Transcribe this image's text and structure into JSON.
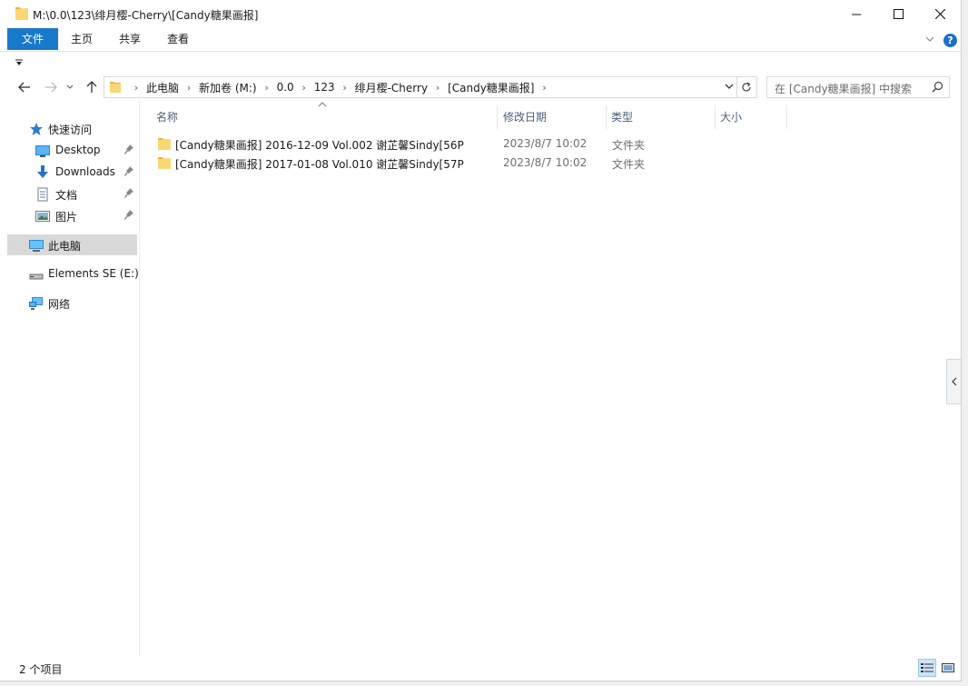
{
  "window": {
    "title": "M:\\0.0\\123\\绯月樱-Cherry\\[Candy糖果画报]"
  },
  "ribbon": {
    "tabs": [
      "文件",
      "主页",
      "共享",
      "查看"
    ],
    "help_label": "?"
  },
  "address": {
    "crumbs": [
      "此电脑",
      "新加卷 (M:)",
      "0.0",
      "123",
      "绯月樱-Cherry",
      "[Candy糖果画报]"
    ],
    "separator": "›"
  },
  "search": {
    "placeholder": "在 [Candy糖果画报] 中搜索"
  },
  "sidebar": {
    "items": [
      {
        "label": "快速访问",
        "icon": "star-icon"
      },
      {
        "label": "Desktop",
        "icon": "desktop-icon",
        "pinned": true
      },
      {
        "label": "Downloads",
        "icon": "download-icon",
        "pinned": true
      },
      {
        "label": "文档",
        "icon": "document-icon",
        "pinned": true
      },
      {
        "label": "图片",
        "icon": "picture-icon",
        "pinned": true
      },
      {
        "label": "此电脑",
        "icon": "computer-icon",
        "selected": true
      },
      {
        "label": "Elements SE (E:)",
        "icon": "drive-icon"
      },
      {
        "label": "网络",
        "icon": "network-icon"
      }
    ]
  },
  "columns": {
    "name": "名称",
    "date": "修改日期",
    "type": "类型",
    "size": "大小"
  },
  "files": [
    {
      "name": "[Candy糖果画报] 2016-12-09 Vol.002 谢芷馨Sindy[56P",
      "date": "2023/8/7 10:02",
      "type": "文件夹"
    },
    {
      "name": "[Candy糖果画报] 2017-01-08 Vol.010 谢芷馨Sindy[57P",
      "date": "2023/8/7 10:02",
      "type": "文件夹"
    }
  ],
  "status": {
    "count_text": "2 个项目"
  },
  "colors": {
    "accent": "#1979ca",
    "folder": "#f8d775",
    "selected": "#d9d9d9"
  }
}
